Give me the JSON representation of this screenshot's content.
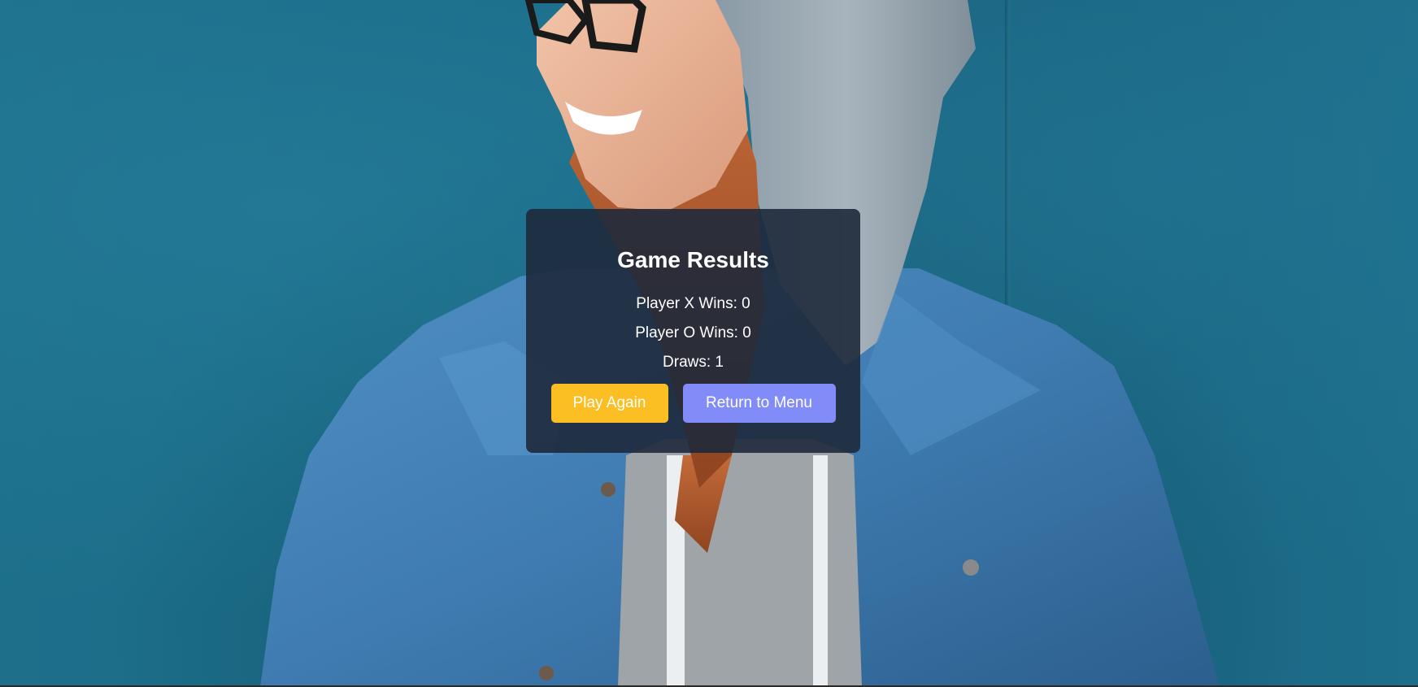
{
  "results": {
    "title": "Game Results",
    "stats": [
      {
        "label": "Player X Wins: 0"
      },
      {
        "label": "Player O Wins: 0"
      },
      {
        "label": "Draws: 1"
      }
    ],
    "buttons": {
      "play_again": "Play Again",
      "return_to_menu": "Return to Menu"
    }
  },
  "colors": {
    "panel_bg": "#1e293b",
    "play_again_button": "#fbbf24",
    "return_to_menu_button": "#818cf8",
    "wall": "#1d6f8a"
  }
}
